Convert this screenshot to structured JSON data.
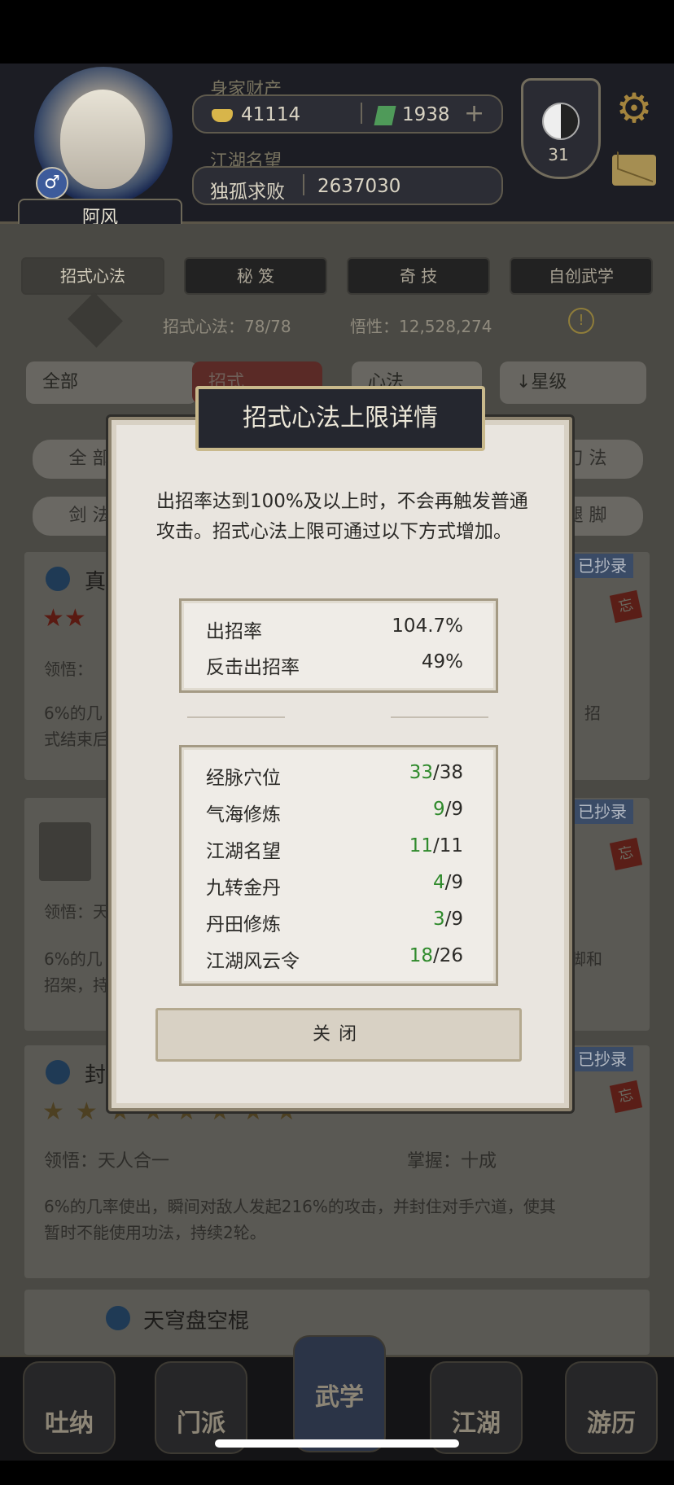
{
  "header": {
    "wealth_label": "身家财产",
    "gold": "41114",
    "jade": "1938",
    "add_symbol": "+",
    "fame_label": "江湖名望",
    "title": "独孤求败",
    "fame_value": "2637030",
    "player_name": "阿风",
    "gender_symbol": "♂",
    "rank": "31"
  },
  "tabs": [
    "招式心法",
    "秘 笈",
    "奇 技",
    "自创武学"
  ],
  "stats": {
    "moves": "招式心法：78/78",
    "insight": "悟性：12,528,274"
  },
  "filters": {
    "all": "全部",
    "move": "招式",
    "mind": "心法",
    "sort": "↓星级"
  },
  "chips": [
    "全 部",
    "刀 法",
    "剑 法",
    "腿 脚"
  ],
  "cards": [
    {
      "title": "真",
      "comprehend": "领悟：",
      "desc1": "6%的几",
      "desc2": "式结束后",
      "tail": "，招",
      "copied": "已抄录",
      "tag": "忘"
    },
    {
      "comprehend": "领悟：天",
      "desc1": "6%的几",
      "desc2": "招架，持",
      "tail": "脚和",
      "copied": "已抄录",
      "tag": "忘"
    },
    {
      "title": "封",
      "comprehend": "领悟：天人合一",
      "mastery": "掌握：十成",
      "desc1": "6%的几率使出，瞬间对敌人发起216%的攻击，并封住对手穴道，使其",
      "desc2": "暂时不能使用功法，持续2轮。",
      "copied": "已抄录",
      "tag": "忘"
    },
    {
      "title": "天穹盘空棍"
    }
  ],
  "card_stars": [
    {
      "level": 2
    },
    {
      "level": 8
    }
  ],
  "nav": [
    "吐纳",
    "门派",
    "武学",
    "江湖",
    "游历"
  ],
  "modal": {
    "title": "招式心法上限详情",
    "description": "出招率达到100%及以上时，不会再触发普通攻击。招式心法上限可通过以下方式增加。",
    "rates": [
      {
        "label": "出招率",
        "value": "104.7%"
      },
      {
        "label": "反击出招率",
        "value": "49%"
      }
    ],
    "sources": [
      {
        "label": "经脉穴位",
        "current": "33",
        "max": "/38"
      },
      {
        "label": "气海修炼",
        "current": "9",
        "max": "/9"
      },
      {
        "label": "江湖名望",
        "current": "11",
        "max": "/11"
      },
      {
        "label": "九转金丹",
        "current": "4",
        "max": "/9"
      },
      {
        "label": "丹田修炼",
        "current": "3",
        "max": "/9"
      },
      {
        "label": "江湖风云令",
        "current": "18",
        "max": "/26"
      }
    ],
    "close_label": "关闭"
  },
  "colors": {
    "accent_green": "#2f8a2c",
    "gold_border": "#c9b98c"
  }
}
